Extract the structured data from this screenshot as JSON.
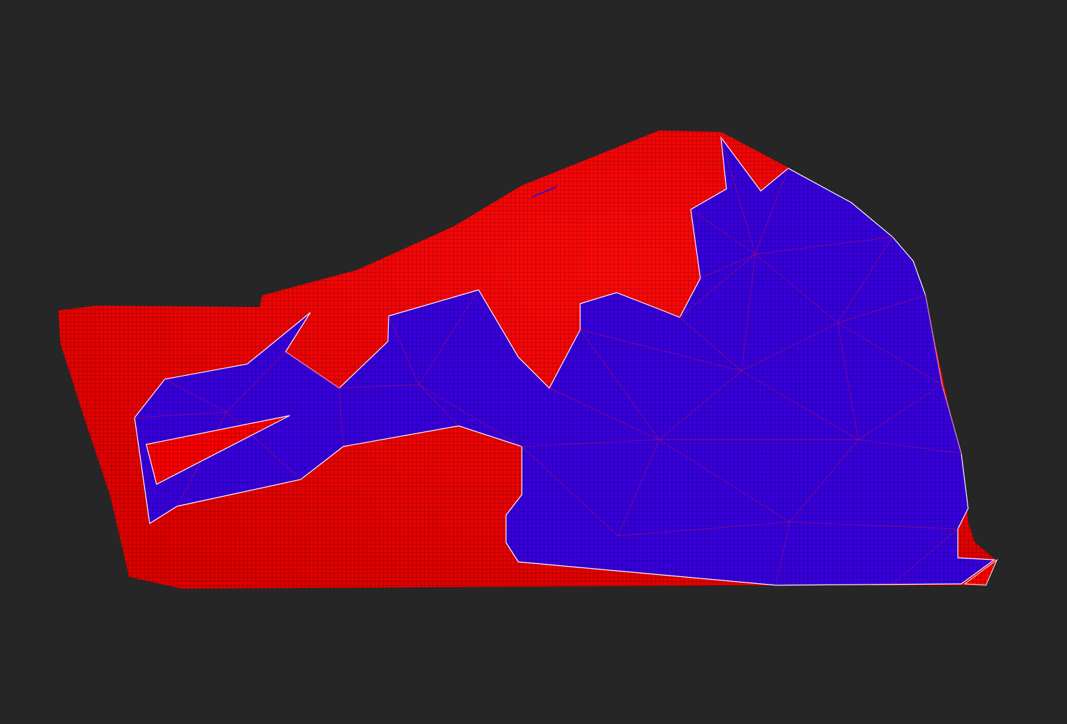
{
  "viewport": {
    "background": "#262626"
  },
  "scene": {
    "background_region": {
      "name": "red-grid-surface",
      "fill": "#ff0000",
      "grid_color": "#7a0000"
    },
    "overlay_region": {
      "name": "blue-triangulated-surface",
      "fill": "#3a00d8",
      "grid_color": "#1400a0",
      "mesh_color": "#c01060",
      "outline_color": "#ffffff"
    },
    "hole_region": {
      "name": "triangular-hole",
      "outline_color": "#ffffff"
    },
    "corner_sliver": {
      "name": "corner-sliver",
      "outline_color": "#ffffff"
    }
  }
}
